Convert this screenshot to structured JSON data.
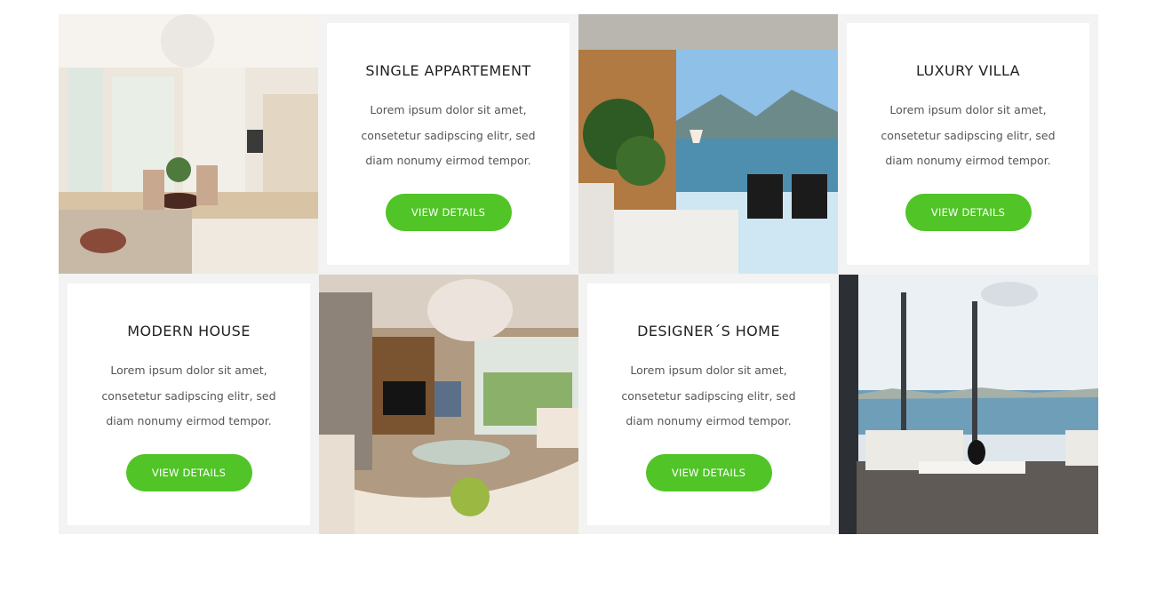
{
  "properties": [
    {
      "title": "SINGLE APPARTEMENT",
      "description": "Lorem ipsum dolor sit amet, consetetur sadipscing elitr, sed diam nonumy eirmod tempor.",
      "button": "VIEW DETAILS"
    },
    {
      "title": "LUXURY VILLA",
      "description": "Lorem ipsum dolor sit amet, consetetur sadipscing elitr, sed diam nonumy eirmod tempor.",
      "button": "VIEW DETAILS"
    },
    {
      "title": "MODERN HOUSE",
      "description": "Lorem ipsum dolor sit amet, consetetur sadipscing elitr, sed diam nonumy eirmod tempor.",
      "button": "VIEW DETAILS"
    },
    {
      "title": "DESIGNER´S HOME",
      "description": "Lorem ipsum dolor sit amet, consetetur sadipscing elitr, sed diam nonumy eirmod tempor.",
      "button": "VIEW DETAILS"
    }
  ],
  "colors": {
    "accent": "#51c428",
    "panel": "#f3f3f3",
    "card": "#ffffff"
  }
}
